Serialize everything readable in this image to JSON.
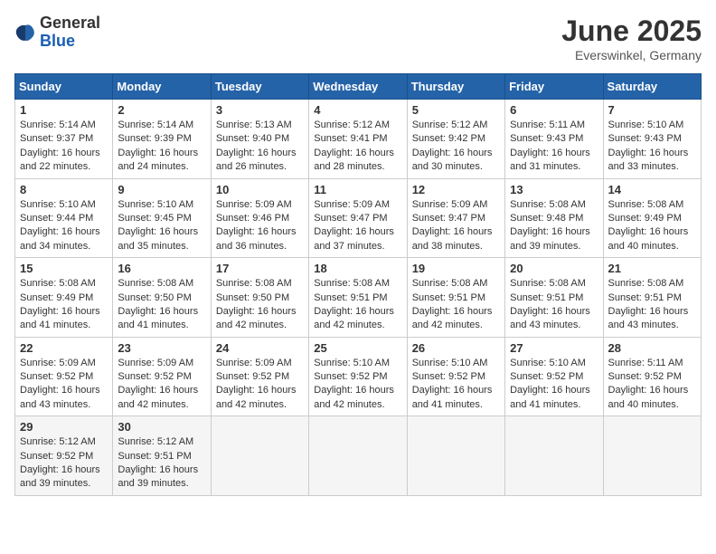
{
  "logo": {
    "general": "General",
    "blue": "Blue"
  },
  "title": {
    "month_year": "June 2025",
    "location": "Everswinkel, Germany"
  },
  "days_of_week": [
    "Sunday",
    "Monday",
    "Tuesday",
    "Wednesday",
    "Thursday",
    "Friday",
    "Saturday"
  ],
  "weeks": [
    [
      {
        "day": "1",
        "sunrise": "5:14 AM",
        "sunset": "9:37 PM",
        "daylight": "16 hours and 22 minutes."
      },
      {
        "day": "2",
        "sunrise": "5:14 AM",
        "sunset": "9:39 PM",
        "daylight": "16 hours and 24 minutes."
      },
      {
        "day": "3",
        "sunrise": "5:13 AM",
        "sunset": "9:40 PM",
        "daylight": "16 hours and 26 minutes."
      },
      {
        "day": "4",
        "sunrise": "5:12 AM",
        "sunset": "9:41 PM",
        "daylight": "16 hours and 28 minutes."
      },
      {
        "day": "5",
        "sunrise": "5:12 AM",
        "sunset": "9:42 PM",
        "daylight": "16 hours and 30 minutes."
      },
      {
        "day": "6",
        "sunrise": "5:11 AM",
        "sunset": "9:43 PM",
        "daylight": "16 hours and 31 minutes."
      },
      {
        "day": "7",
        "sunrise": "5:10 AM",
        "sunset": "9:43 PM",
        "daylight": "16 hours and 33 minutes."
      }
    ],
    [
      {
        "day": "8",
        "sunrise": "5:10 AM",
        "sunset": "9:44 PM",
        "daylight": "16 hours and 34 minutes."
      },
      {
        "day": "9",
        "sunrise": "5:10 AM",
        "sunset": "9:45 PM",
        "daylight": "16 hours and 35 minutes."
      },
      {
        "day": "10",
        "sunrise": "5:09 AM",
        "sunset": "9:46 PM",
        "daylight": "16 hours and 36 minutes."
      },
      {
        "day": "11",
        "sunrise": "5:09 AM",
        "sunset": "9:47 PM",
        "daylight": "16 hours and 37 minutes."
      },
      {
        "day": "12",
        "sunrise": "5:09 AM",
        "sunset": "9:47 PM",
        "daylight": "16 hours and 38 minutes."
      },
      {
        "day": "13",
        "sunrise": "5:08 AM",
        "sunset": "9:48 PM",
        "daylight": "16 hours and 39 minutes."
      },
      {
        "day": "14",
        "sunrise": "5:08 AM",
        "sunset": "9:49 PM",
        "daylight": "16 hours and 40 minutes."
      }
    ],
    [
      {
        "day": "15",
        "sunrise": "5:08 AM",
        "sunset": "9:49 PM",
        "daylight": "16 hours and 41 minutes."
      },
      {
        "day": "16",
        "sunrise": "5:08 AM",
        "sunset": "9:50 PM",
        "daylight": "16 hours and 41 minutes."
      },
      {
        "day": "17",
        "sunrise": "5:08 AM",
        "sunset": "9:50 PM",
        "daylight": "16 hours and 42 minutes."
      },
      {
        "day": "18",
        "sunrise": "5:08 AM",
        "sunset": "9:51 PM",
        "daylight": "16 hours and 42 minutes."
      },
      {
        "day": "19",
        "sunrise": "5:08 AM",
        "sunset": "9:51 PM",
        "daylight": "16 hours and 42 minutes."
      },
      {
        "day": "20",
        "sunrise": "5:08 AM",
        "sunset": "9:51 PM",
        "daylight": "16 hours and 43 minutes."
      },
      {
        "day": "21",
        "sunrise": "5:08 AM",
        "sunset": "9:51 PM",
        "daylight": "16 hours and 43 minutes."
      }
    ],
    [
      {
        "day": "22",
        "sunrise": "5:09 AM",
        "sunset": "9:52 PM",
        "daylight": "16 hours and 43 minutes."
      },
      {
        "day": "23",
        "sunrise": "5:09 AM",
        "sunset": "9:52 PM",
        "daylight": "16 hours and 42 minutes."
      },
      {
        "day": "24",
        "sunrise": "5:09 AM",
        "sunset": "9:52 PM",
        "daylight": "16 hours and 42 minutes."
      },
      {
        "day": "25",
        "sunrise": "5:10 AM",
        "sunset": "9:52 PM",
        "daylight": "16 hours and 42 minutes."
      },
      {
        "day": "26",
        "sunrise": "5:10 AM",
        "sunset": "9:52 PM",
        "daylight": "16 hours and 41 minutes."
      },
      {
        "day": "27",
        "sunrise": "5:10 AM",
        "sunset": "9:52 PM",
        "daylight": "16 hours and 41 minutes."
      },
      {
        "day": "28",
        "sunrise": "5:11 AM",
        "sunset": "9:52 PM",
        "daylight": "16 hours and 40 minutes."
      }
    ],
    [
      {
        "day": "29",
        "sunrise": "5:12 AM",
        "sunset": "9:52 PM",
        "daylight": "16 hours and 39 minutes."
      },
      {
        "day": "30",
        "sunrise": "5:12 AM",
        "sunset": "9:51 PM",
        "daylight": "16 hours and 39 minutes."
      },
      null,
      null,
      null,
      null,
      null
    ]
  ]
}
